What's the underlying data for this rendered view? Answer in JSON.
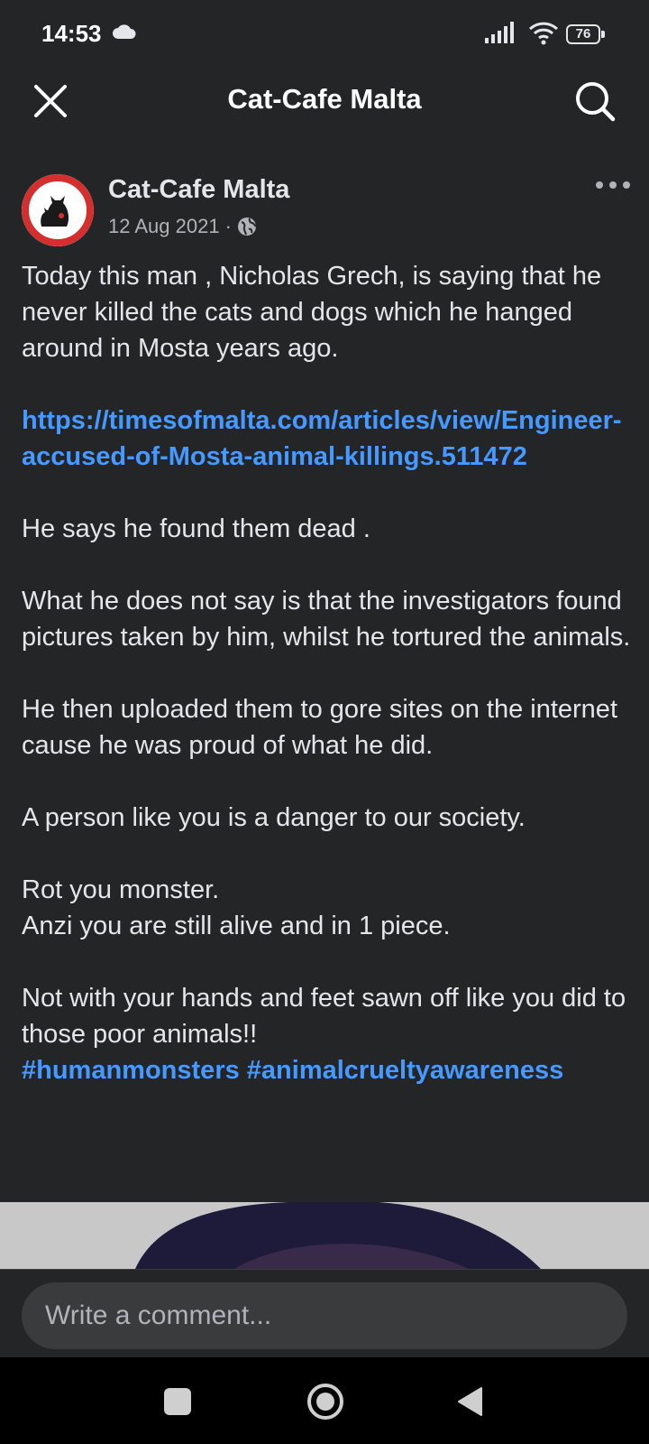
{
  "status_bar": {
    "time": "14:53",
    "battery": "76"
  },
  "header": {
    "title": "Cat-Cafe Malta"
  },
  "post": {
    "author": "Cat-Cafe Malta",
    "date": "12 Aug 2021",
    "separator": "·",
    "paragraphs": {
      "p1": "Today this man , Nicholas Grech,  is saying that he never killed the cats and dogs which he hanged around in Mosta years ago.",
      "link": "https://timesofmalta.com/articles/view/Engineer-accused-of-Mosta-animal-killings.511472",
      "p2": "He says he found them dead .",
      "p3": "What he does not say is that the investigators found pictures taken by him, whilst he tortured the animals.",
      "p4": "He then uploaded  them to gore sites on the internet cause he was proud of what he did.",
      "p5": "A person like you is a danger to our society.",
      "p6": "Rot you monster.",
      "p7": "Anzi you are still alive and in 1 piece.",
      "p8": "Not with your hands and feet sawn off like you did to those poor animals!!",
      "hashtags": "#humanmonsters #animalcrueltyawareness"
    }
  },
  "comment": {
    "placeholder": "Write a comment..."
  },
  "colors": {
    "background": "#242526",
    "link": "#4599ff",
    "text": "#e4e6eb",
    "muted": "#b0b3b8"
  },
  "icons": {
    "close": "close-icon",
    "search": "search-icon",
    "more": "more-options-icon",
    "globe": "globe-icon"
  }
}
